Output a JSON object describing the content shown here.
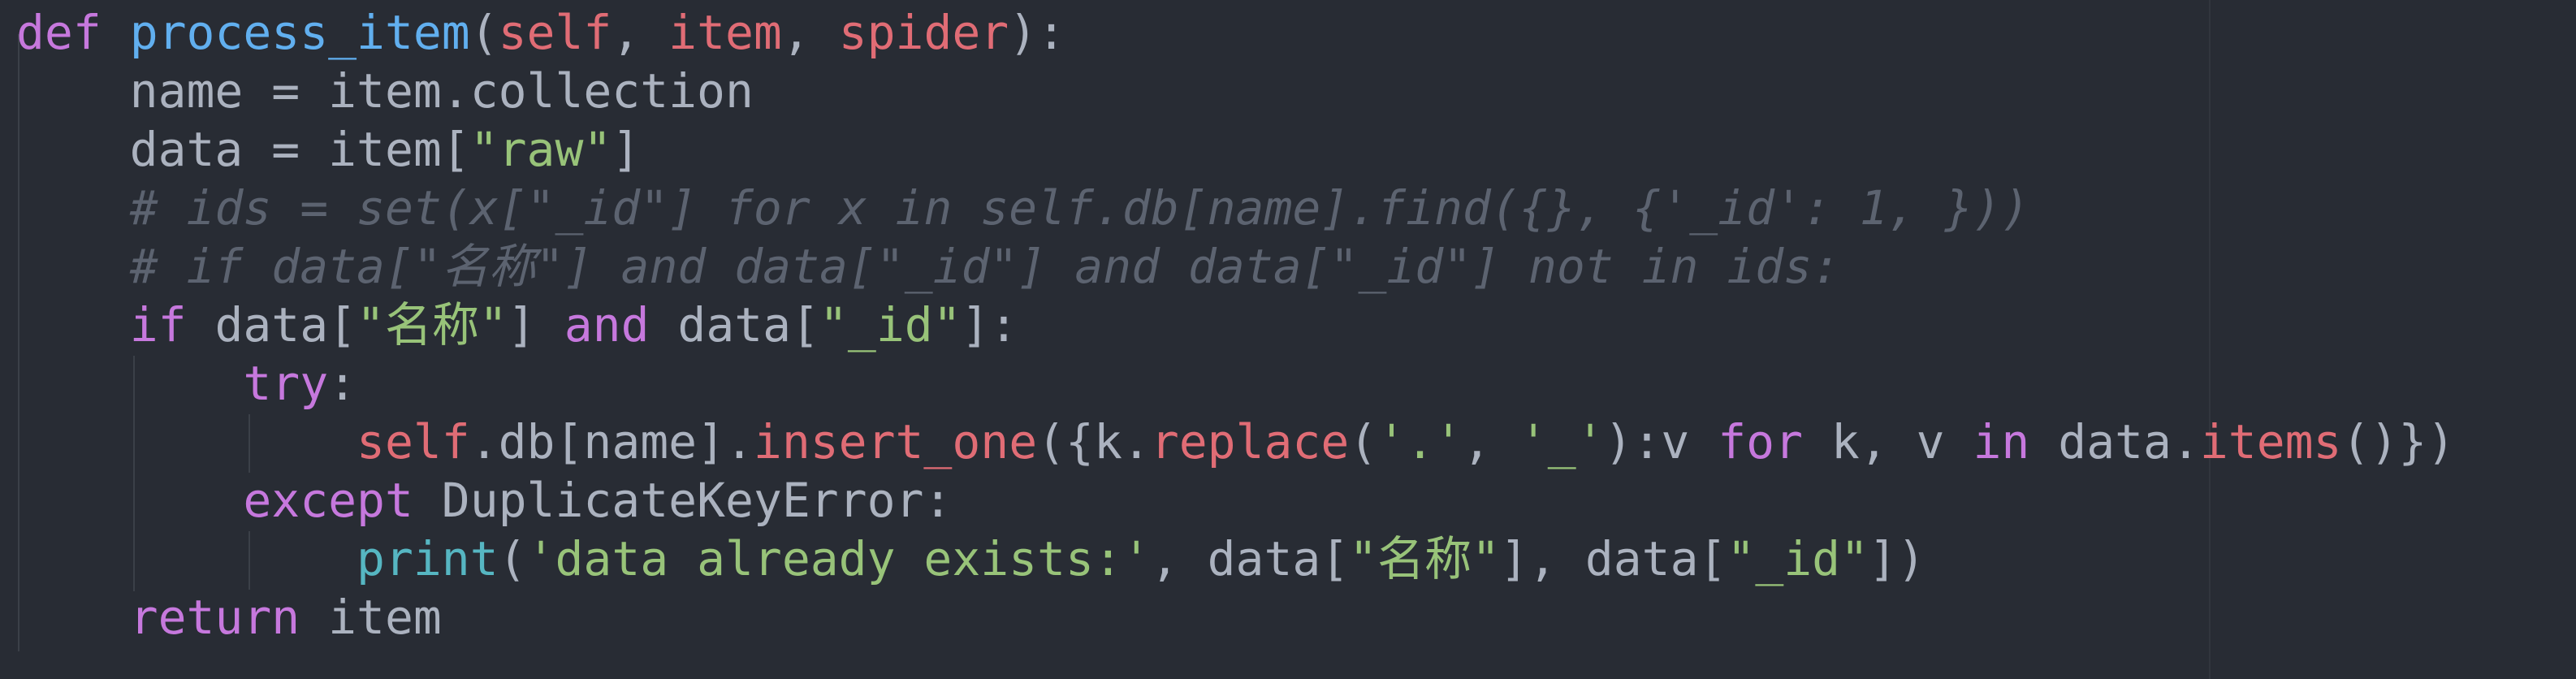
{
  "colors": {
    "background": "#282c34",
    "plain": "#abb2bf",
    "keyword": "#c678dd",
    "function": "#61afef",
    "self_param": "#e06c75",
    "string": "#98c379",
    "comment": "#5c6370",
    "builtin": "#56b6c2",
    "indent_guide": "#3b4048"
  },
  "lines": [
    {
      "tokens": [
        {
          "t": "def",
          "c": "kw"
        },
        {
          "t": " ",
          "c": ""
        },
        {
          "t": "process_item",
          "c": "fn"
        },
        {
          "t": "(",
          "c": ""
        },
        {
          "t": "self",
          "c": "param"
        },
        {
          "t": ", ",
          "c": ""
        },
        {
          "t": "item",
          "c": "param"
        },
        {
          "t": ", ",
          "c": ""
        },
        {
          "t": "spider",
          "c": "param"
        },
        {
          "t": "):",
          "c": ""
        }
      ]
    },
    {
      "tokens": [
        {
          "t": "    name = item.collection",
          "c": ""
        }
      ]
    },
    {
      "tokens": [
        {
          "t": "    data = item[",
          "c": ""
        },
        {
          "t": "\"raw\"",
          "c": "str"
        },
        {
          "t": "]",
          "c": ""
        }
      ]
    },
    {
      "tokens": [
        {
          "t": "    ",
          "c": ""
        },
        {
          "t": "# ids = set(x[\"_id\"] for x in self.db[name].find({}, {'_id': 1, }))",
          "c": "cm"
        }
      ]
    },
    {
      "tokens": [
        {
          "t": "    ",
          "c": ""
        },
        {
          "t": "# if data[\"名称\"] and data[\"_id\"] and data[\"_id\"] not in ids:",
          "c": "cm"
        }
      ]
    },
    {
      "tokens": [
        {
          "t": "    ",
          "c": ""
        },
        {
          "t": "if",
          "c": "kw"
        },
        {
          "t": " data[",
          "c": ""
        },
        {
          "t": "\"名称\"",
          "c": "str"
        },
        {
          "t": "] ",
          "c": ""
        },
        {
          "t": "and",
          "c": "kw"
        },
        {
          "t": " data[",
          "c": ""
        },
        {
          "t": "\"_id\"",
          "c": "str"
        },
        {
          "t": "]:",
          "c": ""
        }
      ]
    },
    {
      "tokens": [
        {
          "t": "        ",
          "c": ""
        },
        {
          "t": "try",
          "c": "kw"
        },
        {
          "t": ":",
          "c": ""
        }
      ]
    },
    {
      "tokens": [
        {
          "t": "            ",
          "c": ""
        },
        {
          "t": "self",
          "c": "self"
        },
        {
          "t": ".db[name].",
          "c": ""
        },
        {
          "t": "insert_one",
          "c": "self"
        },
        {
          "t": "({k.",
          "c": ""
        },
        {
          "t": "replace",
          "c": "self"
        },
        {
          "t": "(",
          "c": ""
        },
        {
          "t": "'.'",
          "c": "str"
        },
        {
          "t": ", ",
          "c": ""
        },
        {
          "t": "'_'",
          "c": "str"
        },
        {
          "t": "):v ",
          "c": ""
        },
        {
          "t": "for",
          "c": "kw"
        },
        {
          "t": " k, v ",
          "c": ""
        },
        {
          "t": "in",
          "c": "kw"
        },
        {
          "t": " data.",
          "c": ""
        },
        {
          "t": "items",
          "c": "self"
        },
        {
          "t": "()})",
          "c": ""
        }
      ]
    },
    {
      "tokens": [
        {
          "t": "        ",
          "c": ""
        },
        {
          "t": "except",
          "c": "kw"
        },
        {
          "t": " DuplicateKeyError:",
          "c": ""
        }
      ]
    },
    {
      "tokens": [
        {
          "t": "            ",
          "c": ""
        },
        {
          "t": "print",
          "c": "bi"
        },
        {
          "t": "(",
          "c": ""
        },
        {
          "t": "'data already exists:'",
          "c": "str"
        },
        {
          "t": ", data[",
          "c": ""
        },
        {
          "t": "\"名称\"",
          "c": "str"
        },
        {
          "t": "], data[",
          "c": ""
        },
        {
          "t": "\"_id\"",
          "c": "str"
        },
        {
          "t": "])",
          "c": ""
        }
      ]
    },
    {
      "tokens": [
        {
          "t": "    ",
          "c": ""
        },
        {
          "t": "return",
          "c": "kw"
        },
        {
          "t": " item",
          "c": ""
        }
      ]
    }
  ]
}
